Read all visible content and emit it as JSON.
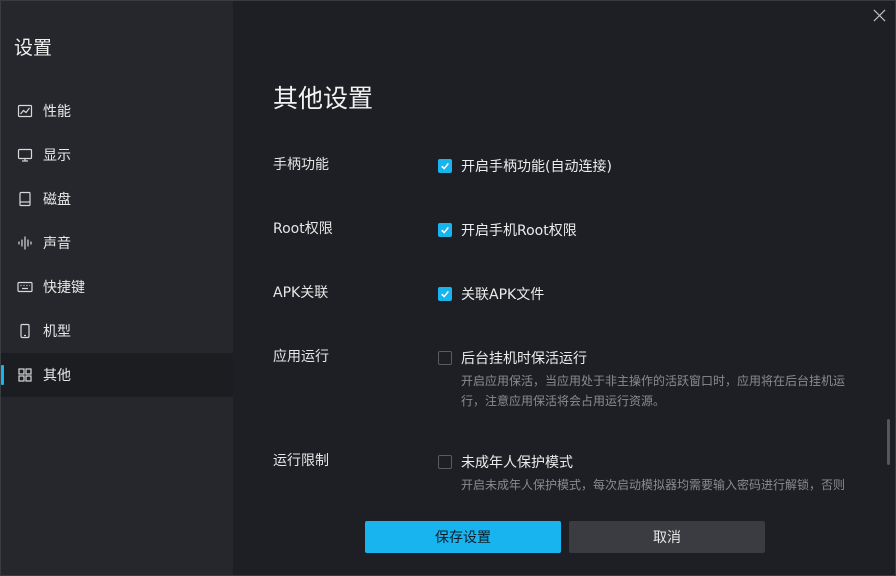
{
  "sidebar": {
    "title": "设置",
    "items": [
      {
        "label": "性能",
        "icon": "chart-line-icon"
      },
      {
        "label": "显示",
        "icon": "monitor-icon"
      },
      {
        "label": "磁盘",
        "icon": "disk-icon"
      },
      {
        "label": "声音",
        "icon": "sound-wave-icon"
      },
      {
        "label": "快捷键",
        "icon": "keyboard-icon"
      },
      {
        "label": "机型",
        "icon": "phone-icon"
      },
      {
        "label": "其他",
        "icon": "grid-icon"
      }
    ],
    "active": "其他"
  },
  "main": {
    "title": "其他设置",
    "rows": [
      {
        "label": "手柄功能",
        "option": "开启手柄功能(自动连接)",
        "checked": true
      },
      {
        "label": "Root权限",
        "option": "开启手机Root权限",
        "checked": true
      },
      {
        "label": "APK关联",
        "option": "关联APK文件",
        "checked": true
      },
      {
        "label": "应用运行",
        "option": "后台挂机时保活运行",
        "checked": false,
        "desc": "开启应用保活，当应用处于非主操作的活跃窗口时，应用将在后台挂机运行，注意应用保活将会占用运行资源。"
      },
      {
        "label": "运行限制",
        "option": "未成年人保护模式",
        "checked": false,
        "desc": "开启未成年人保护模式，每次启动模拟器均需要输入密码进行解锁，否则无法使用模拟器。"
      }
    ]
  },
  "buttons": {
    "save": "保存设置",
    "cancel": "取消"
  },
  "colors": {
    "accent": "#18b4f0",
    "sidebar_bg": "#26272c",
    "main_bg": "#1e1f24"
  }
}
